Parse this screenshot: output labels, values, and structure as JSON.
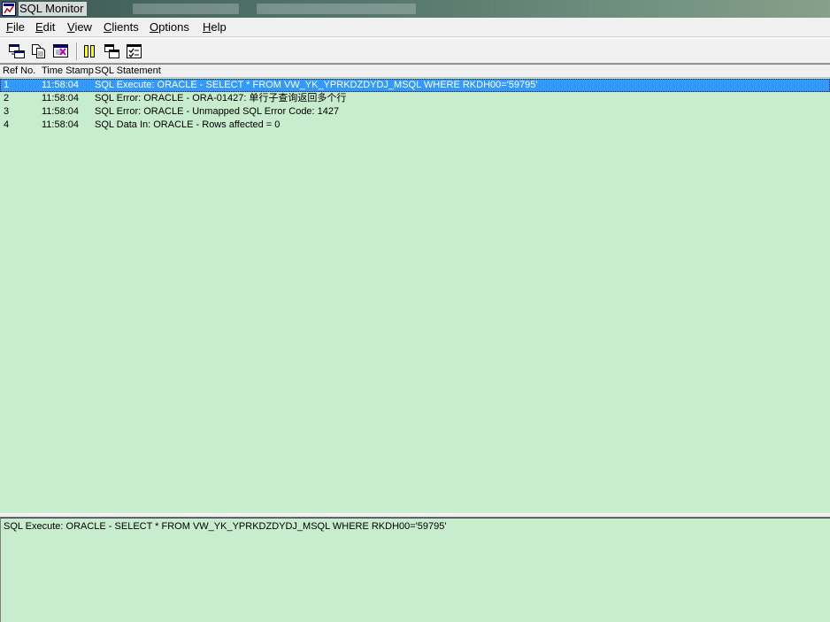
{
  "window": {
    "title": "SQL Monitor"
  },
  "menu": [
    {
      "pre": "",
      "key": "F",
      "post": "ile"
    },
    {
      "pre": "",
      "key": "E",
      "post": "dit"
    },
    {
      "pre": "",
      "key": "V",
      "post": "iew"
    },
    {
      "pre": "",
      "key": "C",
      "post": "lients"
    },
    {
      "pre": "",
      "key": "O",
      "post": "ptions"
    },
    {
      "pre": "",
      "key": "H",
      "post": "elp"
    }
  ],
  "toolbar": {
    "buttons": [
      "copy-log-icon",
      "copy-icon",
      "clear-log-icon",
      "pause-icon",
      "cascade-windows-icon",
      "options-icon"
    ]
  },
  "list": {
    "columns": [
      "Ref No.",
      "Time Stamp",
      "SQL Statement"
    ],
    "rows": [
      {
        "ref": "1",
        "time": "11:58:04",
        "stmt": "SQL Execute: ORACLE - SELECT * FROM VW_YK_YPRKDZDYDJ_MSQL WHERE RKDH00='59795'",
        "selected": true
      },
      {
        "ref": "2",
        "time": "11:58:04",
        "stmt": "SQL Error: ORACLE - ORA-01427: 单行子查询返回多个行",
        "selected": false
      },
      {
        "ref": "3",
        "time": "11:58:04",
        "stmt": "SQL Error: ORACLE - Unmapped SQL Error Code: 1427",
        "selected": false
      },
      {
        "ref": "4",
        "time": "11:58:04",
        "stmt": "SQL Data In: ORACLE - Rows affected = 0",
        "selected": false
      }
    ]
  },
  "detail": {
    "text": "SQL Execute: ORACLE - SELECT * FROM VW_YK_YPRKDZDYDJ_MSQL WHERE RKDH00='59795'"
  },
  "colors": {
    "pane_background": "#c8ecce",
    "selection": "#3399ff",
    "chrome": "#f0f0f0"
  }
}
